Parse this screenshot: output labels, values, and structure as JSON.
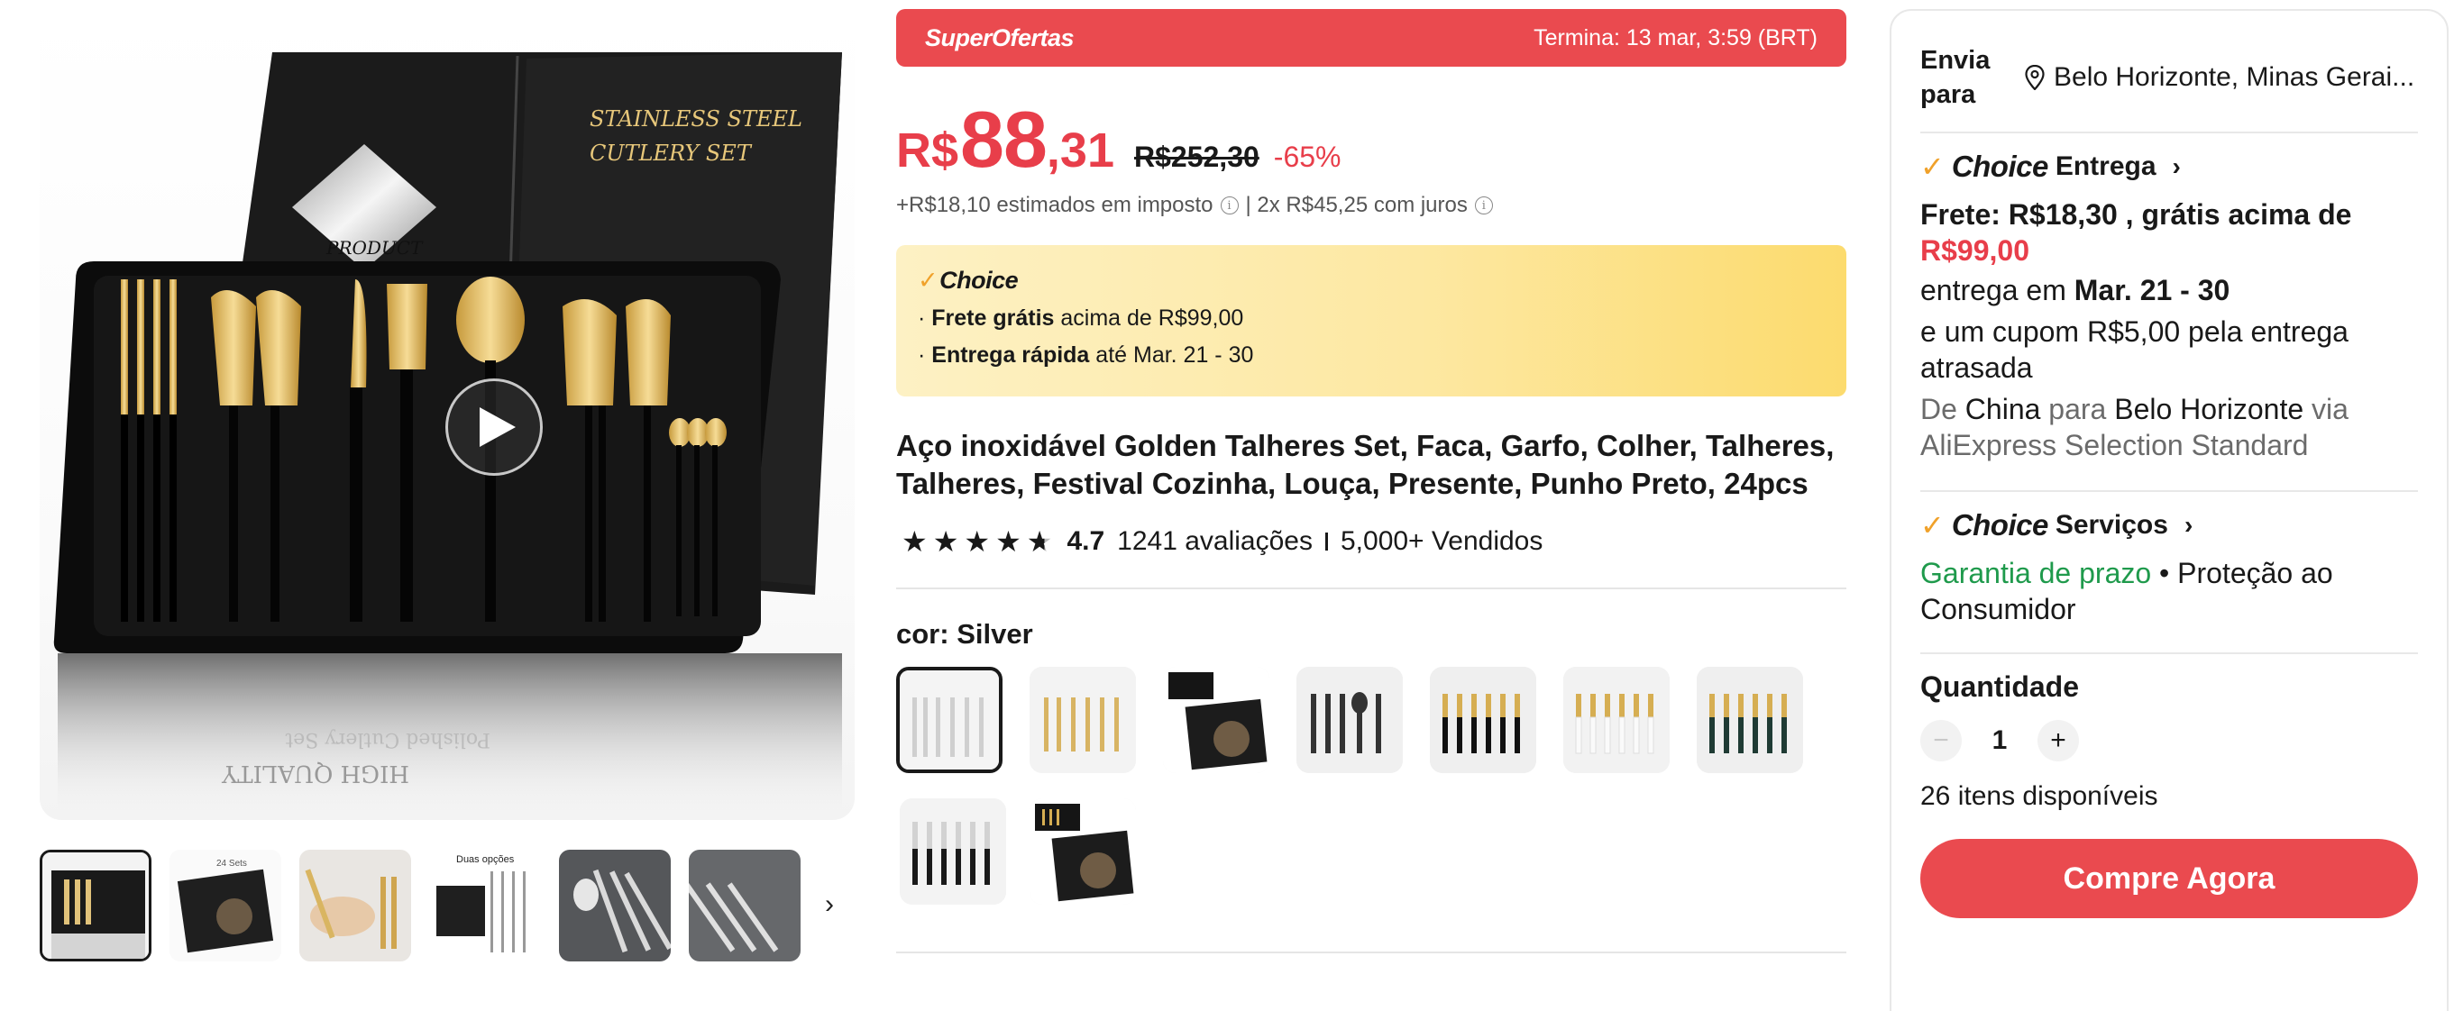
{
  "gallery": {
    "main_image": "cutlery-set-gift-box",
    "box_text_1": "STAINLESS STEEL",
    "box_text_2": "CUTLERY SET",
    "box_text_3": "PRODUCT",
    "reflection_text_1": "Polished Cutlery Set",
    "reflection_text_2": "HIGH QUALITY",
    "thumbnails": [
      {
        "name": "thumb-1",
        "active": true
      },
      {
        "name": "thumb-2",
        "caption": "24 Sets"
      },
      {
        "name": "thumb-3"
      },
      {
        "name": "thumb-4",
        "caption": "Duas opções"
      },
      {
        "name": "thumb-5"
      },
      {
        "name": "thumb-6"
      }
    ]
  },
  "promo": {
    "label": "SuperOfertas",
    "ends": "Termina: 13 mar, 3:59 (BRT)"
  },
  "price": {
    "currency": "R$",
    "integer": "88",
    "decimal": ",31",
    "original": "R$252,30",
    "discount": "-65%",
    "tax_note": "+R$18,10 estimados em imposto",
    "installments": "| 2x R$45,25 com juros"
  },
  "choice_box": {
    "logo": "Choice",
    "line1_bold": "Frete grátis",
    "line1_rest": " acima de R$99,00",
    "line2_bold": "Entrega rápida",
    "line2_rest": " até Mar. 21 - 30",
    "bullet": "·"
  },
  "product": {
    "title": "Aço inoxidável Golden Talheres Set, Faca, Garfo, Colher, Talheres, Talheres, Festival Cozinha, Louça, Presente, Punho Preto, 24pcs",
    "rating": "4.7",
    "rating_stars": 4.7,
    "reviews": "1241 avaliações",
    "sold": "5,000+ Vendidos"
  },
  "variant": {
    "label_prefix": "cor: ",
    "selected": "Silver",
    "options": [
      {
        "name": "silver",
        "selected": true
      },
      {
        "name": "gold"
      },
      {
        "name": "gift-box"
      },
      {
        "name": "black"
      },
      {
        "name": "black-gold"
      },
      {
        "name": "white-gold"
      },
      {
        "name": "green-gold"
      },
      {
        "name": "black-silver"
      },
      {
        "name": "gift-box-2"
      }
    ]
  },
  "shipping": {
    "label": "Envia para",
    "location": "Belo Horizonte, Minas Gerai...",
    "choice_word": "Choice",
    "delivery_title": "Entrega",
    "frete_text": "Frete: R$18,30 , grátis acima de",
    "frete_threshold": "R$99,00",
    "delivery_prefix": "entrega em ",
    "delivery_dates": "Mar. 21 - 30",
    "coupon": "e um cupom R$5,00 pela entrega atrasada",
    "route_from_label": "De",
    "route_from": "China",
    "route_to_label": "para",
    "route_to": "Belo Horizonte",
    "route_via_label": "via",
    "route_via": "AliExpress Selection Standard"
  },
  "services": {
    "title": "Serviços",
    "guarantee": "Garantia de prazo",
    "protection": " • Proteção ao Consumidor"
  },
  "quantity": {
    "label": "Quantidade",
    "value": "1",
    "minus": "−",
    "plus": "+",
    "available": "26 itens disponíveis"
  },
  "buy_now": "Compre Agora",
  "colors": {
    "accent": "#ea4a4f",
    "price_red": "#e83e4a",
    "choice_check": "#f0a12a",
    "green": "#1f9a4c"
  }
}
